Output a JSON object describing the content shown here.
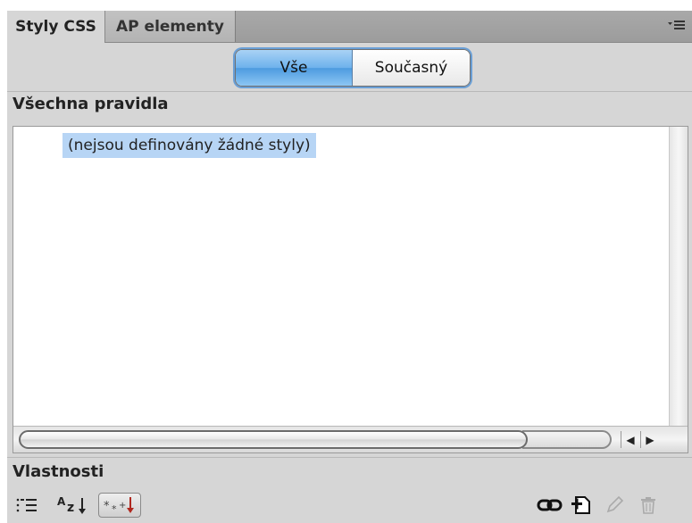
{
  "tabs": [
    {
      "label": "Styly CSS",
      "active": true
    },
    {
      "label": "AP elementy",
      "active": false
    }
  ],
  "view_toggle": {
    "all_label": "Vše",
    "current_label": "Současný",
    "selected": "Vše"
  },
  "rules_section": {
    "title": "Všechna pravidla",
    "empty_message": "(nejsou definovány žádné styly)"
  },
  "properties_section": {
    "title": "Vlastnosti"
  },
  "toolbar": {
    "left_icons": [
      "category-view-icon",
      "alphabetical-view-icon",
      "set-properties-only-icon"
    ],
    "right_icons": [
      "attach-stylesheet-icon",
      "new-css-rule-icon",
      "edit-style-icon",
      "delete-css-rule-icon"
    ]
  },
  "colors": {
    "panel_bg": "#d6d6d6",
    "selection_highlight": "#b7d5f5",
    "segment_active": "#6eb2ec"
  }
}
